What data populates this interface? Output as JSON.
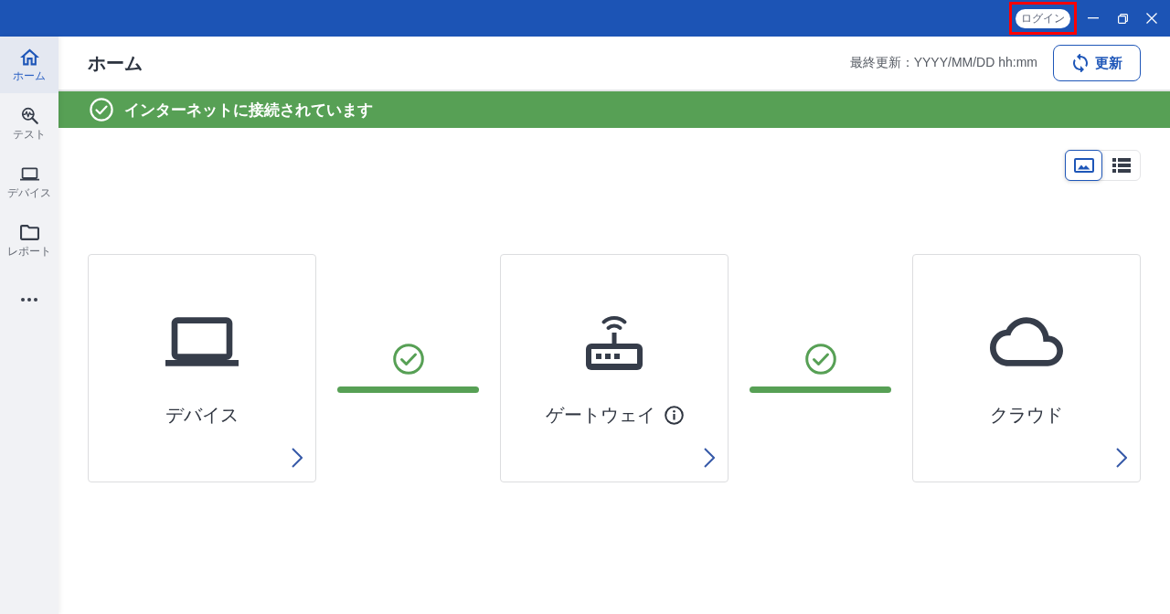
{
  "title_bar": {
    "login_button": {
      "label": "ログイン",
      "highlighted": true
    }
  },
  "sidebar": {
    "items": [
      {
        "label": "ホーム",
        "selected": true
      },
      {
        "label": "テスト",
        "selected": false
      },
      {
        "label": "デバイス",
        "selected": false
      },
      {
        "label": "レポート",
        "selected": false
      }
    ]
  },
  "header": {
    "title": "ホーム",
    "last_updated": "最終更新：YYYY/MM/DD hh:mm",
    "refresh_button": "更新"
  },
  "banner": {
    "message": "インターネットに接続されています"
  },
  "view_toggle": [
    {
      "selected": true
    },
    {
      "selected": false
    }
  ],
  "diagram": {
    "nodes": [
      {
        "label": "デバイス",
        "info": false
      },
      {
        "label": "ゲートウェイ",
        "info": true
      },
      {
        "label": "クラウド",
        "info": false
      }
    ],
    "links": [
      {
        "connected": true
      },
      {
        "connected": true
      }
    ]
  }
}
